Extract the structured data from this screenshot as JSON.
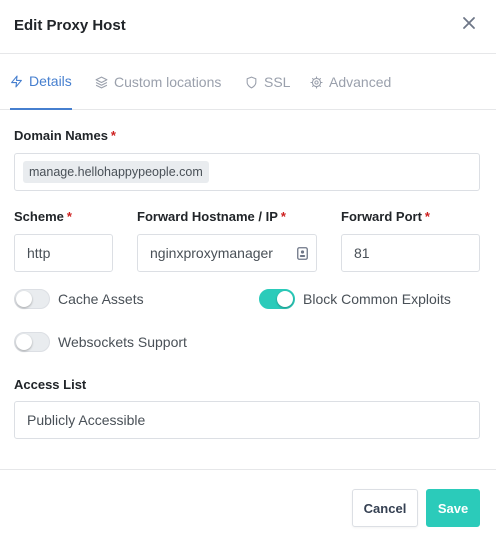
{
  "header": {
    "title": "Edit Proxy Host"
  },
  "tabs": [
    {
      "label": "Details",
      "icon": "bolt-icon",
      "active": true
    },
    {
      "label": "Custom locations",
      "icon": "layers-icon",
      "active": false
    },
    {
      "label": "SSL",
      "icon": "shield-icon",
      "active": false
    },
    {
      "label": "Advanced",
      "icon": "gear-icon",
      "active": false
    }
  ],
  "form": {
    "domain_names": {
      "label": "Domain Names",
      "required_mark": "*",
      "values": [
        "manage.hellohappypeople.com"
      ]
    },
    "scheme": {
      "label": "Scheme",
      "required_mark": "*",
      "value": "http"
    },
    "forward_host": {
      "label": "Forward Hostname / IP",
      "required_mark": "*",
      "value": "nginxproxymanager"
    },
    "forward_port": {
      "label": "Forward Port",
      "required_mark": "*",
      "value": "81"
    },
    "cache_assets": {
      "label": "Cache Assets",
      "enabled": false
    },
    "block_exploits": {
      "label": "Block Common Exploits",
      "enabled": true
    },
    "websockets": {
      "label": "Websockets Support",
      "enabled": false
    },
    "access_list": {
      "label": "Access List",
      "value": "Publicly Accessible"
    }
  },
  "footer": {
    "cancel_label": "Cancel",
    "save_label": "Save"
  },
  "colors": {
    "accent": "#2bcbba",
    "tab_active": "#467fcf",
    "required": "#cd201f"
  }
}
